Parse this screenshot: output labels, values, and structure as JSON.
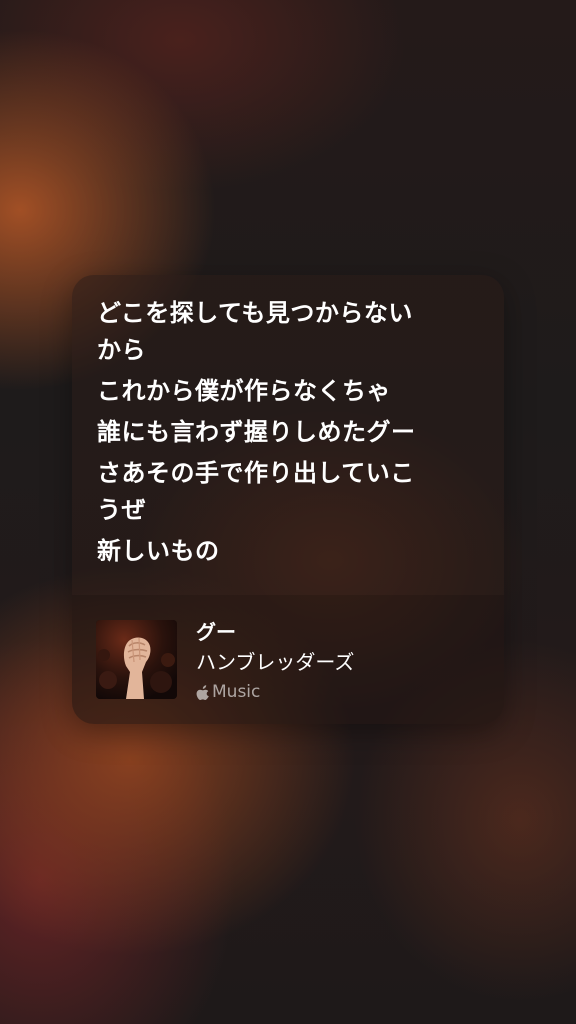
{
  "lyrics": {
    "lines": [
      "どこを探しても見つからない\nから",
      "これから僕が作らなくちゃ",
      "誰にも言わず握りしめたグー",
      "さあその手で作り出していこ\nうぜ",
      "新しいもの"
    ]
  },
  "song": {
    "title": "グー",
    "artist": "ハンブレッダーズ",
    "service_label": "Music",
    "service_icon": "apple-logo-icon",
    "artwork_icon": "raised-fist-artwork"
  },
  "colors": {
    "text": "#ffffff",
    "muted_text": "#9a8f8c",
    "card_bg": "#2a1c18",
    "accent_warm": "#a85226"
  }
}
